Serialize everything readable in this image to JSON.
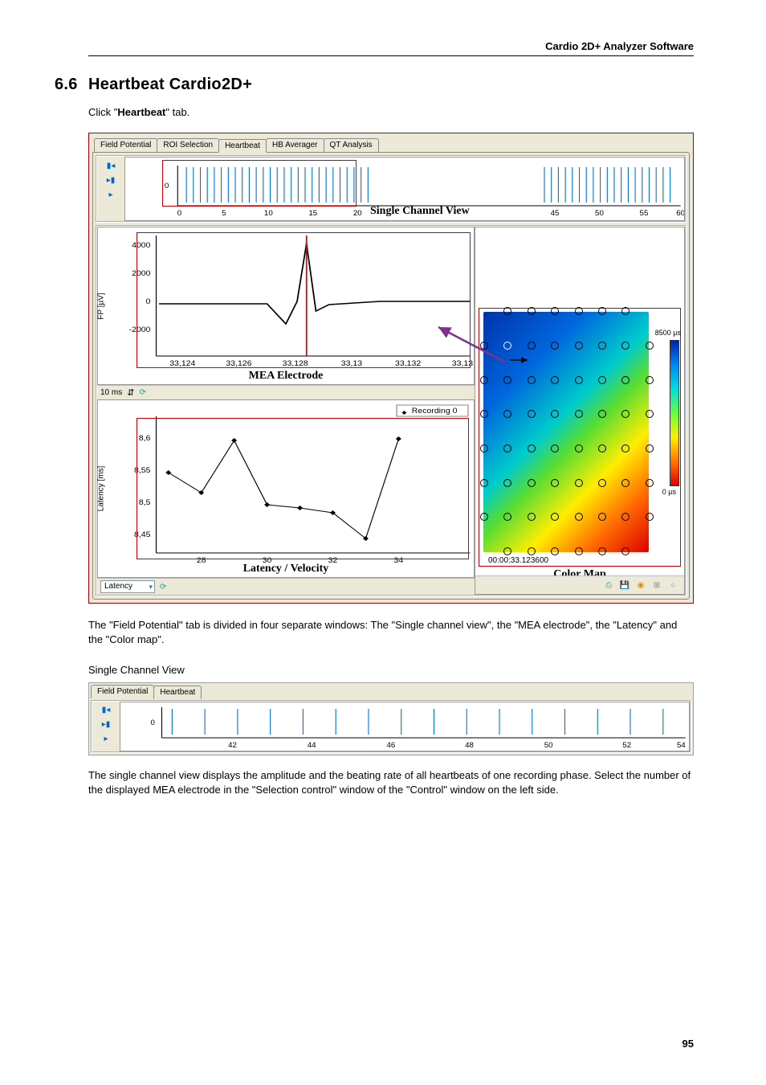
{
  "header": "Cardio 2D+ Analyzer Software",
  "section_num": "6.6",
  "section_title": "Heartbeat Cardio2D+",
  "intro_prefix": "Click \"",
  "intro_bold": "Heartbeat",
  "intro_suffix": "\" tab.",
  "tabs": [
    "Field Potential",
    "ROI Selection",
    "Heartbeat",
    "HB Averager",
    "QT Analysis"
  ],
  "scv_title": "Single Channel View",
  "scv_y0": "0",
  "scv_xticks": [
    "0",
    "5",
    "10",
    "15",
    "20",
    "45",
    "50",
    "55",
    "60"
  ],
  "fp_ylabel": "FP [µV]",
  "fp_yticks": [
    "4000",
    "2000",
    "0",
    "-2000"
  ],
  "fp_xticks": [
    "33,124",
    "33,126",
    "33,128",
    "33,13",
    "33,132",
    "33,13"
  ],
  "fp_title": "MEA Electrode",
  "fp_xres": "10 ms",
  "latency_ylabel": "Latency [ms]",
  "lat_yticks": [
    "8,6",
    "8,55",
    "8,5",
    "8,45"
  ],
  "lat_xticks": [
    "28",
    "30",
    "32",
    "34"
  ],
  "lat_title": "Latency / Velocity",
  "lat_legend": "Recording 0",
  "select_val": "Latency",
  "cbar_top": "8500 µs",
  "cbar_bot": "0 µs",
  "timestamp": "00:00:33.123600",
  "colormap_title": "Color Map",
  "para1": "The \"Field Potential\" tab is divided in four separate windows: The \"Single channel view\", the \"MEA electrode\", the \"Latency\" and the \"Color map\".",
  "subhead": "Single Channel View",
  "tabs2": [
    "Field Potential",
    "Heartbeat"
  ],
  "scv2_y0": "0",
  "scv2_xticks": [
    "42",
    "44",
    "46",
    "48",
    "50",
    "52",
    "54"
  ],
  "para2": "The single channel view displays the amplitude and the beating rate of all heartbeats of one recording phase. Select the number of the displayed MEA electrode in the  \"Selection control\" window of the \"Control\" window on the left side.",
  "page_num": "95",
  "chart_data": [
    {
      "type": "line",
      "name": "single_channel_view_main",
      "xlim": [
        0,
        60
      ],
      "ylim": [
        -1,
        1
      ],
      "yticks": [
        0
      ],
      "xticks": [
        0,
        5,
        10,
        15,
        20,
        45,
        50,
        55,
        60
      ],
      "note": "vertical spike events at roughly x = 3–60 at ~0.8 interval",
      "title": "Single Channel View"
    },
    {
      "type": "line",
      "name": "mea_electrode_waveform",
      "xlabel": "",
      "ylabel": "FP [µV]",
      "ylim": [
        -2500,
        4200
      ],
      "xlim": [
        33.123,
        33.134
      ],
      "xticks": [
        33.124,
        33.126,
        33.128,
        33.13,
        33.132,
        33.134
      ],
      "yticks": [
        -2000,
        0,
        2000,
        4000
      ],
      "title": "MEA Electrode",
      "series": [
        {
          "name": "FP",
          "x": [
            33.124,
            33.126,
            33.1275,
            33.128,
            33.1285,
            33.129,
            33.131,
            33.133
          ],
          "y": [
            0,
            0,
            -1200,
            0,
            4000,
            -200,
            100,
            0
          ]
        }
      ],
      "cursor_x": 33.128
    },
    {
      "type": "line",
      "name": "latency_velocity",
      "xlabel": "",
      "ylabel": "Latency [ms]",
      "ylim": [
        8.43,
        8.62
      ],
      "xlim": [
        27,
        35
      ],
      "xticks": [
        28,
        30,
        32,
        34
      ],
      "yticks": [
        8.45,
        8.5,
        8.55,
        8.6
      ],
      "title": "Latency / Velocity",
      "series": [
        {
          "name": "Recording 0",
          "x": [
            27,
            28,
            29,
            30,
            31,
            32,
            33,
            34
          ],
          "y": [
            8.55,
            8.51,
            8.6,
            8.5,
            8.49,
            8.48,
            8.44,
            8.6
          ]
        }
      ]
    },
    {
      "type": "heatmap",
      "name": "color_map",
      "grid": "8x8 electrode",
      "value_range_us": [
        0,
        8500
      ],
      "timestamp": "00:00:33.123600",
      "origin_electrode_rowcol": [
        2,
        2
      ],
      "title": "Color Map"
    },
    {
      "type": "line",
      "name": "single_channel_view_small",
      "xlim": [
        41,
        55
      ],
      "ylim": [
        -1,
        1
      ],
      "yticks": [
        0
      ],
      "xticks": [
        42,
        44,
        46,
        48,
        50,
        52,
        54
      ],
      "note": "vertical spike events at roughly x = 41–54 at ~0.8 interval"
    }
  ]
}
